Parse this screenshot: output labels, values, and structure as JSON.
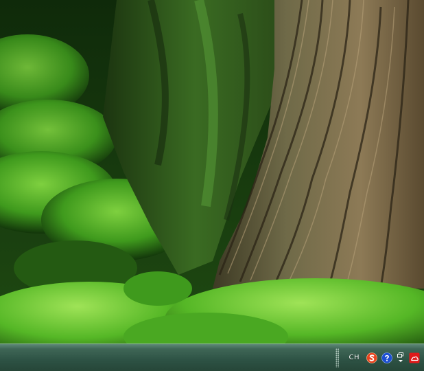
{
  "desktop": {
    "wallpaper": "moss-covered-tree-trunk",
    "colors": {
      "moss": "#59b52a",
      "bark": "#7b6a47",
      "shadow": "#0d1f08"
    }
  },
  "taskbar": {
    "color": "#2d5244",
    "tray": {
      "language_indicator": "CH",
      "icons": [
        "sogou-input-icon",
        "help-icon",
        "restore-down-icon",
        "cloud-icon"
      ]
    }
  }
}
